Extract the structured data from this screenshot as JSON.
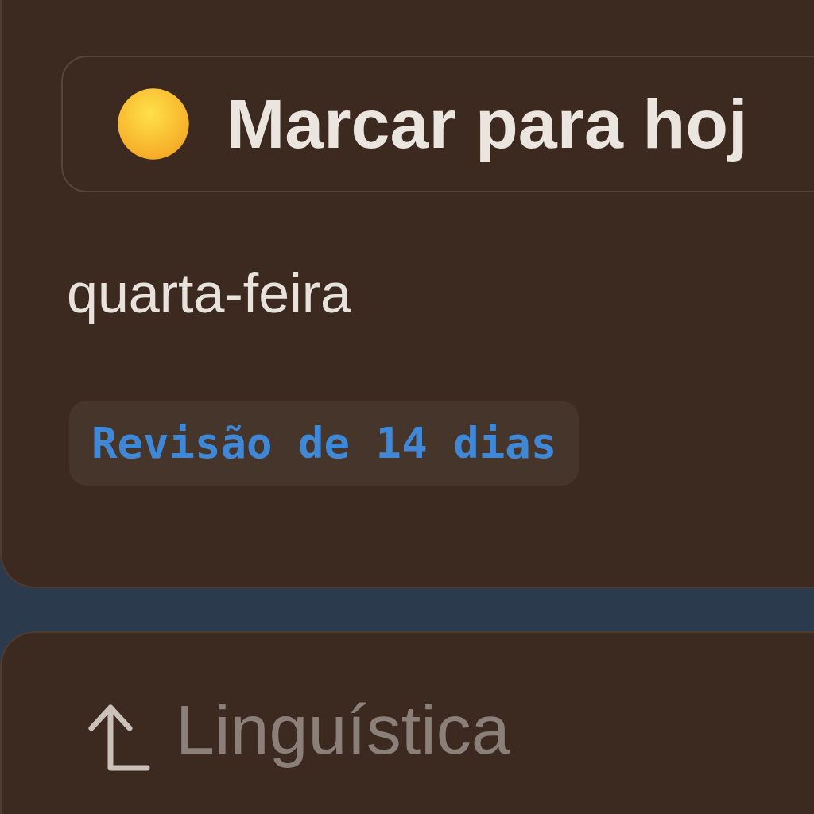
{
  "task_card": {
    "today_button": {
      "label": "Marcar para hoj"
    },
    "due_day": "quarta-feira",
    "tag": "Revisão de 14 dias"
  },
  "next_card": {
    "parent": "Linguística"
  }
}
